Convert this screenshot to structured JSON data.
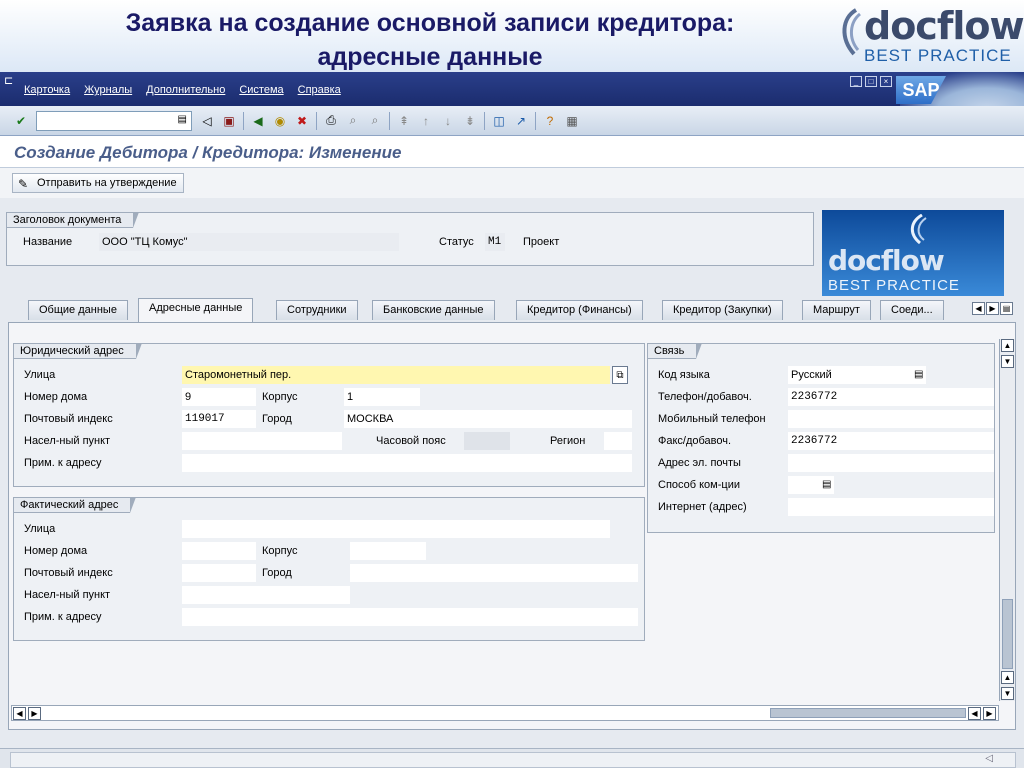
{
  "slide": {
    "title_line1": "Заявка на создание основной записи кредитора:",
    "title_line2": "адресные данные",
    "logo_word": "docflow",
    "logo_sub": "BEST PRACTICE"
  },
  "menu": [
    "Карточка",
    "Журналы",
    "Дополнительно",
    "Система",
    "Справка"
  ],
  "sap_logo": "SAP",
  "screen_title": "Создание Дебитора / Кредитора: Изменение",
  "app_toolbar": {
    "submit_label": "Отправить на утверждение"
  },
  "doc_header": {
    "group_title": "Заголовок документа",
    "name_label": "Название",
    "name_value": "ООО \"ТЦ Комус\"",
    "status_label": "Статус",
    "status_code": "M1",
    "status_text": "Проект"
  },
  "tabs": [
    "Общие данные",
    "Адресные данные",
    "Сотрудники",
    "Банковские данные",
    "Кредитор (Финансы)",
    "Кредитор (Закупки)",
    "Маршрут",
    "Соеди..."
  ],
  "active_tab": "Адресные данные",
  "legal_address": {
    "title": "Юридический адрес",
    "street_label": "Улица",
    "street_value": "Старомонетный пер.",
    "house_label": "Номер дома",
    "house_value": "9",
    "building_label": "Корпус",
    "building_value": "1",
    "postal_label": "Почтовый индекс",
    "postal_value": "119017",
    "city_label": "Город",
    "city_value": "МОСКВА",
    "locality_label": "Насел-ный пункт",
    "timezone_label": "Часовой пояс",
    "region_label": "Регион",
    "note_label": "Прим. к адресу"
  },
  "actual_address": {
    "title": "Фактический адрес",
    "street_label": "Улица",
    "house_label": "Номер дома",
    "building_label": "Корпус",
    "postal_label": "Почтовый индекс",
    "city_label": "Город",
    "locality_label": "Насел-ный пункт",
    "note_label": "Прим. к адресу"
  },
  "contact": {
    "title": "Связь",
    "language_label": "Код языка",
    "language_value": "Русский",
    "phone_label": "Телефон/добавоч.",
    "phone_value": "2236772",
    "mobile_label": "Мобильный телефон",
    "fax_label": "Факс/добавоч.",
    "fax_value": "2236772",
    "email_label": "Адрес эл. почты",
    "comm_method_label": "Способ ком-ции",
    "internet_label": "Интернет (адрес)"
  }
}
